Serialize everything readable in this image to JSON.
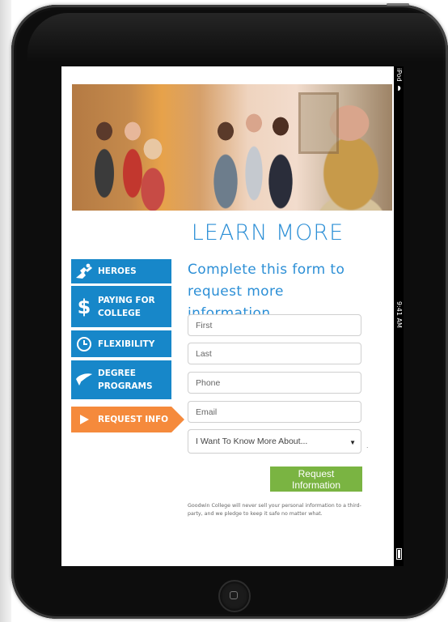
{
  "device": {
    "status_carrier": "iPod",
    "status_time": "9:41 AM"
  },
  "page": {
    "title": "LEARN MORE"
  },
  "nav": {
    "items": [
      {
        "label": "HEROES",
        "icon": "hero-figure-icon",
        "active": false
      },
      {
        "label": "PAYING FOR\nCOLLEGE",
        "icon": "dollar-icon",
        "active": false
      },
      {
        "label": "FLEXIBILITY",
        "icon": "clock-icon",
        "active": false
      },
      {
        "label": "DEGREE\nPROGRAMS",
        "icon": "graduation-cap-icon",
        "active": false
      },
      {
        "label": "REQUEST INFO",
        "icon": "play-arrow-icon",
        "active": true
      }
    ]
  },
  "form": {
    "heading": "Complete this form to request more information",
    "first_placeholder": "First",
    "last_placeholder": "Last",
    "phone_placeholder": "Phone",
    "email_placeholder": "Email",
    "interest_selected": "I Want To Know More About...",
    "submit_label": "Request Information",
    "disclaimer": "Goodwin College will never sell your personal information to a third-party, and we pledge to keep it safe no matter what."
  },
  "colors": {
    "brand_blue": "#1787c9",
    "title_blue": "#2c8fd6",
    "active_orange": "#f58a3c",
    "submit_green": "#7ab442"
  }
}
